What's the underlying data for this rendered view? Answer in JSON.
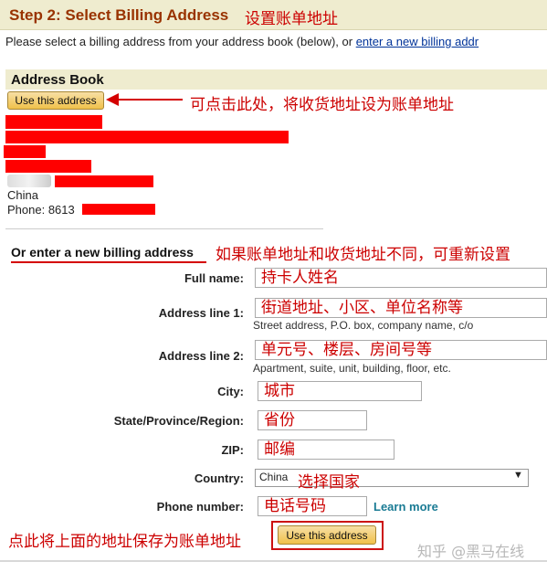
{
  "step": {
    "title": "Step 2: Select Billing Address",
    "annotation": "设置账单地址"
  },
  "intro": {
    "text": "Please select a billing address from your address book (below), or ",
    "link": "enter a new billing addr"
  },
  "address_book": {
    "title": "Address Book",
    "use_button": "Use this address",
    "annotation": "可点击此处，将收货地址设为账单地址",
    "country": "China",
    "phone_prefix": "Phone: 8613"
  },
  "new_address": {
    "title": "Or enter a new billing address",
    "annotation": "如果账单地址和收货地址不同，可重新设置",
    "fields": {
      "full_name": {
        "label": "Full name:",
        "value": "持卡人姓名"
      },
      "address1": {
        "label": "Address line 1:",
        "value": "街道地址、小区、单位名称等",
        "hint": "Street address, P.O. box, company name, c/o"
      },
      "address2": {
        "label": "Address line 2:",
        "value": "单元号、楼层、房间号等",
        "hint": "Apartment, suite, unit, building, floor, etc."
      },
      "city": {
        "label": "City:",
        "value": "城市"
      },
      "state": {
        "label": "State/Province/Region:",
        "value": "省份"
      },
      "zip": {
        "label": "ZIP:",
        "value": "邮编"
      },
      "country": {
        "label": "Country:",
        "selected": "China",
        "annotation": "选择国家"
      },
      "phone": {
        "label": "Phone number:",
        "value": "电话号码",
        "learn_more": "Learn more"
      }
    },
    "save_annotation": "点此将上面的地址保存为账单地址",
    "use_button": "Use this address"
  },
  "watermark": "知乎 @黑马在线",
  "colors": {
    "annotation_red": "#cc0000",
    "header_bg": "#efeccf",
    "title_brown": "#993300",
    "button_gold": "#f0c14b",
    "link_teal": "#1a7b94"
  }
}
